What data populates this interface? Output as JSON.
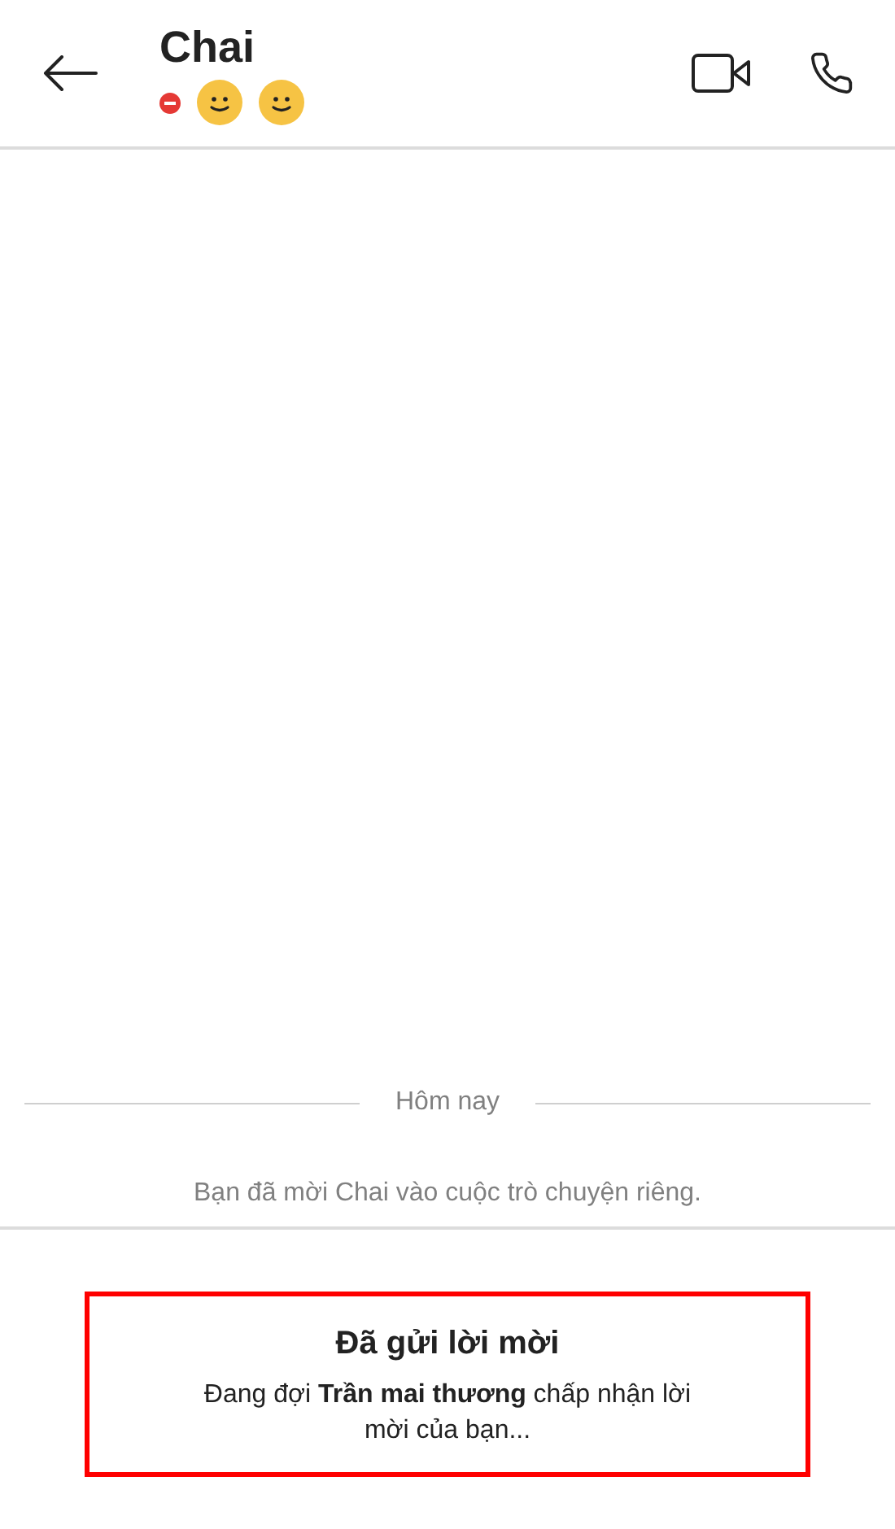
{
  "header": {
    "title": "Chai",
    "badges": [
      {
        "kind": "status",
        "color": "#e53935"
      },
      {
        "kind": "emoji"
      },
      {
        "kind": "emoji"
      }
    ]
  },
  "date_divider": "Hôm nay",
  "system_message": "Bạn đã mời Chai vào cuộc trò chuyện riêng.",
  "invite": {
    "title": "Đã gửi lời mời",
    "message": "Đang đợi **Trần mai thương** chấp nhận lời mời của bạn...",
    "highlighted": true
  }
}
